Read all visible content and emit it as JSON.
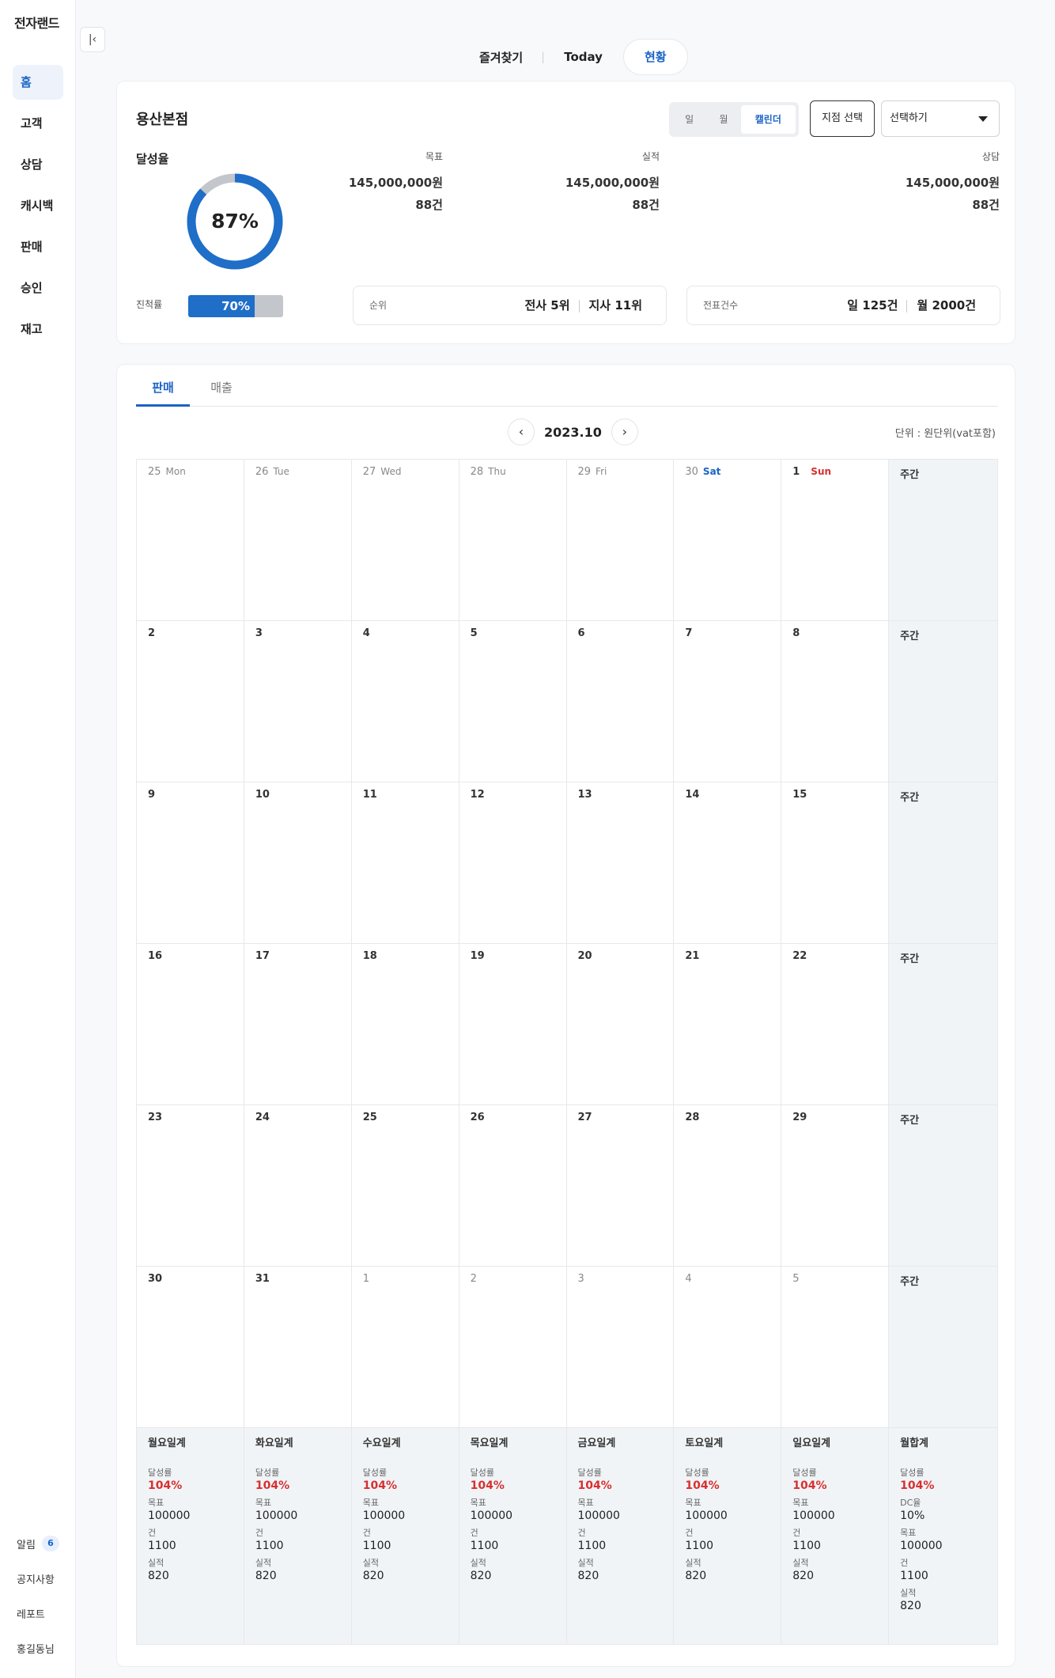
{
  "app": {
    "brand": "전자랜드"
  },
  "sidebar": {
    "items": [
      {
        "label": "홈",
        "active": true
      },
      {
        "label": "고객"
      },
      {
        "label": "상담"
      },
      {
        "label": "캐시백"
      },
      {
        "label": "판매"
      },
      {
        "label": "승인"
      },
      {
        "label": "재고"
      }
    ],
    "bottom": {
      "alerts_label": "알림",
      "alerts_count": "6",
      "notice_label": "공지사항",
      "report_label": "레포트",
      "user_label": "홍길동님"
    }
  },
  "topnav": {
    "favorites": "즐겨찾기",
    "today": "Today",
    "status": "현황"
  },
  "summary": {
    "store_name": "용산본점",
    "view_toggle": {
      "day": "일",
      "month": "월",
      "calendar": "캘린더",
      "active": "캘린더"
    },
    "branch_button": "지점 선택",
    "branch_select": "선택하기",
    "achievement_label": "달성율",
    "achievement_value": "87%",
    "achievement_percent": 87,
    "progress_label": "진척률",
    "progress_value": "70%",
    "progress_percent": 70,
    "stats": [
      {
        "label": "목표",
        "amount": "145,000,000원",
        "count": "88건"
      },
      {
        "label": "실적",
        "amount": "145,000,000원",
        "count": "88건"
      },
      {
        "label": "상담",
        "amount": "145,000,000원",
        "count": "88건"
      }
    ],
    "rank": {
      "label": "순위",
      "company": "전사 5위",
      "branch": "지사 11위"
    },
    "slips": {
      "label": "전표건수",
      "day": "일 125건",
      "month": "월 2000건"
    }
  },
  "calendar": {
    "tabs": [
      {
        "label": "판매",
        "active": true
      },
      {
        "label": "매출"
      }
    ],
    "month": "2023.10",
    "unit": "단위 : 원단위(vat포함)",
    "weekly_label": "주간",
    "first_row": [
      {
        "num": "25",
        "day": "Mon"
      },
      {
        "num": "26",
        "day": "Tue"
      },
      {
        "num": "27",
        "day": "Wed"
      },
      {
        "num": "28",
        "day": "Thu"
      },
      {
        "num": "29",
        "day": "Fri"
      },
      {
        "num": "30",
        "day": "Sat"
      },
      {
        "num": "1",
        "day": "Sun"
      }
    ],
    "weeks": [
      [
        "2",
        "3",
        "4",
        "5",
        "6",
        "7",
        "8"
      ],
      [
        "9",
        "10",
        "11",
        "12",
        "13",
        "14",
        "15"
      ],
      [
        "16",
        "17",
        "18",
        "19",
        "20",
        "21",
        "22"
      ],
      [
        "23",
        "24",
        "25",
        "26",
        "27",
        "28",
        "29"
      ],
      [
        "30",
        "31",
        "1",
        "2",
        "3",
        "4",
        "5"
      ]
    ],
    "summary_cols": [
      {
        "title": "월요일계",
        "rate_label": "달성률",
        "rate": "104%",
        "target_label": "목표",
        "target": "100000",
        "count_label": "건",
        "count": "1100",
        "actual_label": "실적",
        "actual": "820"
      },
      {
        "title": "화요일계",
        "rate_label": "달성률",
        "rate": "104%",
        "target_label": "목표",
        "target": "100000",
        "count_label": "건",
        "count": "1100",
        "actual_label": "실적",
        "actual": "820"
      },
      {
        "title": "수요일계",
        "rate_label": "달성률",
        "rate": "104%",
        "target_label": "목표",
        "target": "100000",
        "count_label": "건",
        "count": "1100",
        "actual_label": "실적",
        "actual": "820"
      },
      {
        "title": "목요일계",
        "rate_label": "달성률",
        "rate": "104%",
        "target_label": "목표",
        "target": "100000",
        "count_label": "건",
        "count": "1100",
        "actual_label": "실적",
        "actual": "820"
      },
      {
        "title": "금요일계",
        "rate_label": "달성률",
        "rate": "104%",
        "target_label": "목표",
        "target": "100000",
        "count_label": "건",
        "count": "1100",
        "actual_label": "실적",
        "actual": "820"
      },
      {
        "title": "토요일계",
        "rate_label": "달성률",
        "rate": "104%",
        "target_label": "목표",
        "target": "100000",
        "count_label": "건",
        "count": "1100",
        "actual_label": "실적",
        "actual": "820"
      },
      {
        "title": "일요일계",
        "rate_label": "달성률",
        "rate": "104%",
        "target_label": "목표",
        "target": "100000",
        "count_label": "건",
        "count": "1100",
        "actual_label": "실적",
        "actual": "820"
      }
    ],
    "monthly_total": {
      "title": "월합계",
      "rate_label": "달성률",
      "rate": "104%",
      "dc_label": "DC율",
      "dc": "10%",
      "target_label": "목표",
      "target": "100000",
      "count_label": "건",
      "count": "1100",
      "actual_label": "실적",
      "actual": "820"
    }
  },
  "colors": {
    "accent": "#1a63c6",
    "progress": "#1f6ec8",
    "track": "#c3c6cb",
    "sunday": "#d8302f",
    "rate_red": "#d8302f",
    "weekly_bg": "#f1f4f7"
  }
}
